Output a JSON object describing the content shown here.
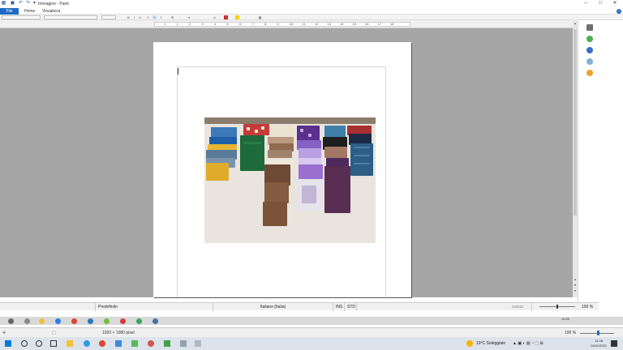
{
  "window": {
    "title": "Immagine - Paint"
  },
  "ribbon": {
    "tabs": [
      "File",
      "Home",
      "Visualizza"
    ]
  },
  "ruler": {
    "numbers": [
      "1",
      "1",
      "2",
      "3",
      "4",
      "5",
      "6",
      "7",
      "8",
      "9",
      "10",
      "11",
      "12",
      "13",
      "14",
      "15",
      "16",
      "17",
      "18"
    ]
  },
  "status_bar": {
    "style": "Predefinito",
    "language": "Italiano (Italia)",
    "mode": "INS",
    "std": "STD",
    "zoom": "100 %"
  },
  "inner_bar": {
    "time": "11:28"
  },
  "paint_status": {
    "dimensions": "1920 × 1080 pixel",
    "zoom": "100 %"
  },
  "taskbar": {
    "weather": "19°C Soleggiato",
    "time": "11:28",
    "date": "04/11/2021"
  },
  "colors": {
    "accent": "#1e6ac4",
    "workspace": "#a6a6a6"
  }
}
